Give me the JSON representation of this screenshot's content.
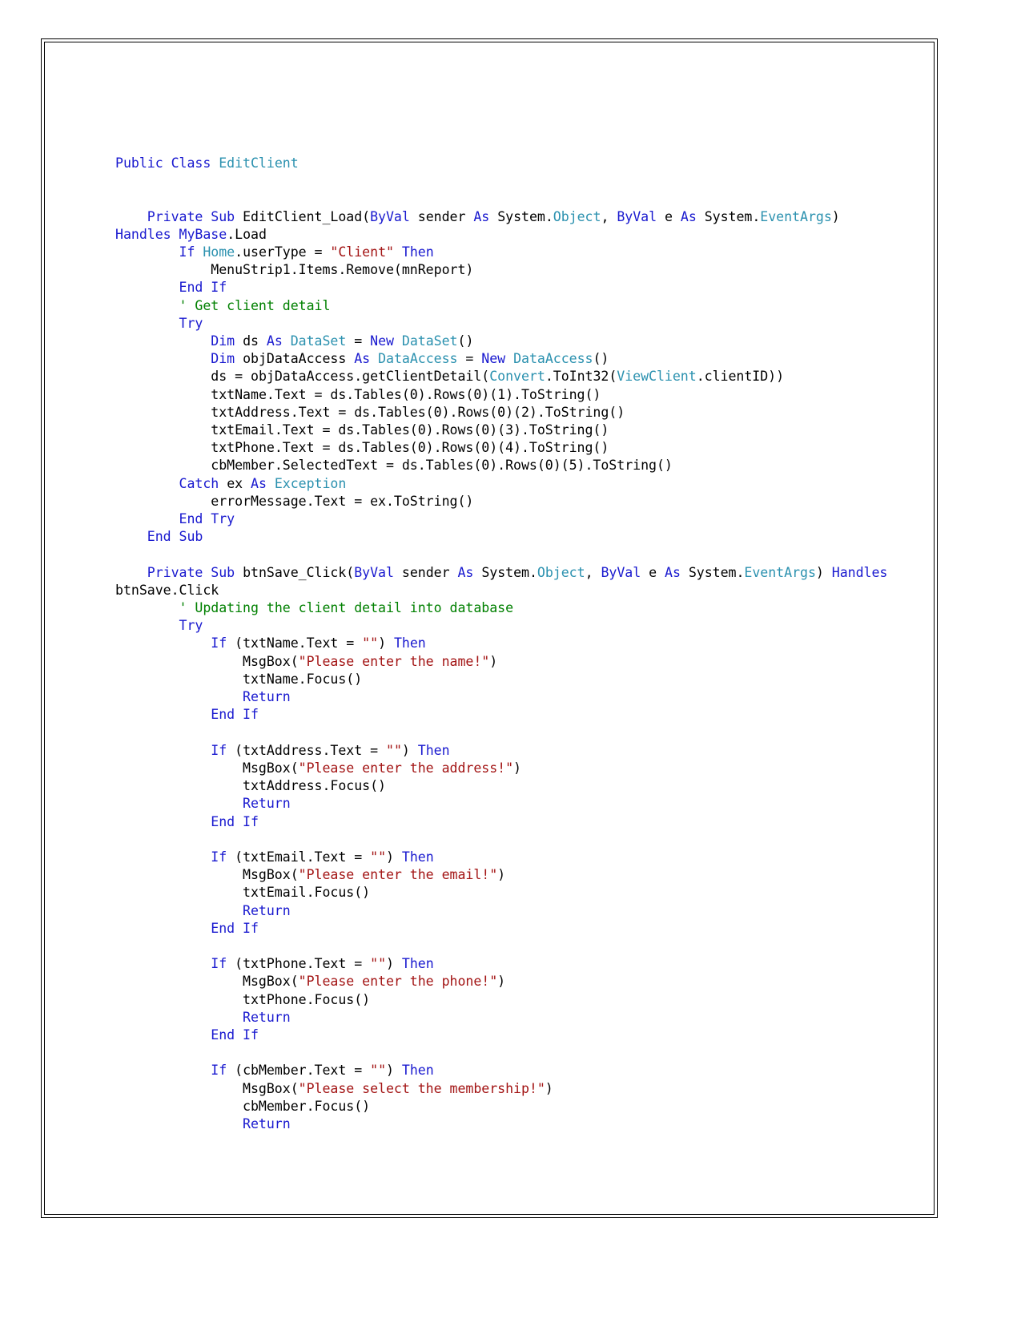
{
  "document": {
    "kind": "source-code-listing",
    "language": "VB.NET",
    "class_name": "EditClient",
    "colors": {
      "keyword": "#1919cf",
      "type": "#2b91af",
      "string": "#a31515",
      "comment": "#008000",
      "plain": "#000000",
      "page_border": "#000000",
      "background": "#ffffff"
    }
  },
  "code": {
    "lines": [
      [
        {
          "t": "kw",
          "v": "Public Class "
        },
        {
          "t": "typ",
          "v": "EditClient"
        }
      ],
      [],
      [],
      [
        {
          "t": "pln",
          "v": "    "
        },
        {
          "t": "kw",
          "v": "Private Sub "
        },
        {
          "t": "pln",
          "v": "EditClient_Load("
        },
        {
          "t": "kw",
          "v": "ByVal "
        },
        {
          "t": "pln",
          "v": "sender "
        },
        {
          "t": "kw",
          "v": "As "
        },
        {
          "t": "pln",
          "v": "System."
        },
        {
          "t": "typ",
          "v": "Object"
        },
        {
          "t": "pln",
          "v": ", "
        },
        {
          "t": "kw",
          "v": "ByVal "
        },
        {
          "t": "pln",
          "v": "e "
        },
        {
          "t": "kw",
          "v": "As "
        },
        {
          "t": "pln",
          "v": "System."
        },
        {
          "t": "typ",
          "v": "EventArgs"
        },
        {
          "t": "pln",
          "v": ") "
        },
        {
          "t": "kw",
          "v": "Handles "
        },
        {
          "t": "kw",
          "v": "MyBase"
        },
        {
          "t": "pln",
          "v": ".Load"
        }
      ],
      [
        {
          "t": "pln",
          "v": "        "
        },
        {
          "t": "kw",
          "v": "If "
        },
        {
          "t": "typ",
          "v": "Home"
        },
        {
          "t": "pln",
          "v": ".userType = "
        },
        {
          "t": "str",
          "v": "\"Client\""
        },
        {
          "t": "pln",
          "v": " "
        },
        {
          "t": "kw",
          "v": "Then"
        }
      ],
      [
        {
          "t": "pln",
          "v": "            MenuStrip1.Items.Remove(mnReport)"
        }
      ],
      [
        {
          "t": "pln",
          "v": "        "
        },
        {
          "t": "kw",
          "v": "End If"
        }
      ],
      [
        {
          "t": "pln",
          "v": "        "
        },
        {
          "t": "cmt",
          "v": "' Get client detail"
        }
      ],
      [
        {
          "t": "pln",
          "v": "        "
        },
        {
          "t": "kw",
          "v": "Try"
        }
      ],
      [
        {
          "t": "pln",
          "v": "            "
        },
        {
          "t": "kw",
          "v": "Dim "
        },
        {
          "t": "pln",
          "v": "ds "
        },
        {
          "t": "kw",
          "v": "As "
        },
        {
          "t": "typ",
          "v": "DataSet"
        },
        {
          "t": "pln",
          "v": " = "
        },
        {
          "t": "kw",
          "v": "New "
        },
        {
          "t": "typ",
          "v": "DataSet"
        },
        {
          "t": "pln",
          "v": "()"
        }
      ],
      [
        {
          "t": "pln",
          "v": "            "
        },
        {
          "t": "kw",
          "v": "Dim "
        },
        {
          "t": "pln",
          "v": "objDataAccess "
        },
        {
          "t": "kw",
          "v": "As "
        },
        {
          "t": "typ",
          "v": "DataAccess"
        },
        {
          "t": "pln",
          "v": " = "
        },
        {
          "t": "kw",
          "v": "New "
        },
        {
          "t": "typ",
          "v": "DataAccess"
        },
        {
          "t": "pln",
          "v": "()"
        }
      ],
      [
        {
          "t": "pln",
          "v": "            ds = objDataAccess.getClientDetail("
        },
        {
          "t": "typ",
          "v": "Convert"
        },
        {
          "t": "pln",
          "v": ".ToInt32("
        },
        {
          "t": "typ",
          "v": "ViewClient"
        },
        {
          "t": "pln",
          "v": ".clientID))"
        }
      ],
      [
        {
          "t": "pln",
          "v": "            txtName.Text = ds.Tables(0).Rows(0)(1).ToString()"
        }
      ],
      [
        {
          "t": "pln",
          "v": "            txtAddress.Text = ds.Tables(0).Rows(0)(2).ToString()"
        }
      ],
      [
        {
          "t": "pln",
          "v": "            txtEmail.Text = ds.Tables(0).Rows(0)(3).ToString()"
        }
      ],
      [
        {
          "t": "pln",
          "v": "            txtPhone.Text = ds.Tables(0).Rows(0)(4).ToString()"
        }
      ],
      [
        {
          "t": "pln",
          "v": "            cbMember.SelectedText = ds.Tables(0).Rows(0)(5).ToString()"
        }
      ],
      [
        {
          "t": "pln",
          "v": "        "
        },
        {
          "t": "kw",
          "v": "Catch "
        },
        {
          "t": "pln",
          "v": "ex "
        },
        {
          "t": "kw",
          "v": "As "
        },
        {
          "t": "typ",
          "v": "Exception"
        }
      ],
      [
        {
          "t": "pln",
          "v": "            errorMessage.Text = ex.ToString()"
        }
      ],
      [
        {
          "t": "pln",
          "v": "        "
        },
        {
          "t": "kw",
          "v": "End Try"
        }
      ],
      [
        {
          "t": "pln",
          "v": "    "
        },
        {
          "t": "kw",
          "v": "End Sub"
        }
      ],
      [],
      [
        {
          "t": "pln",
          "v": "    "
        },
        {
          "t": "kw",
          "v": "Private Sub "
        },
        {
          "t": "pln",
          "v": "btnSave_Click("
        },
        {
          "t": "kw",
          "v": "ByVal "
        },
        {
          "t": "pln",
          "v": "sender "
        },
        {
          "t": "kw",
          "v": "As "
        },
        {
          "t": "pln",
          "v": "System."
        },
        {
          "t": "typ",
          "v": "Object"
        },
        {
          "t": "pln",
          "v": ", "
        },
        {
          "t": "kw",
          "v": "ByVal "
        },
        {
          "t": "pln",
          "v": "e "
        },
        {
          "t": "kw",
          "v": "As "
        },
        {
          "t": "pln",
          "v": "System."
        },
        {
          "t": "typ",
          "v": "EventArgs"
        },
        {
          "t": "pln",
          "v": ") "
        },
        {
          "t": "kw",
          "v": "Handles "
        },
        {
          "t": "pln",
          "v": "btnSave.Click"
        }
      ],
      [
        {
          "t": "pln",
          "v": "        "
        },
        {
          "t": "cmt",
          "v": "' Updating the client detail into database"
        }
      ],
      [
        {
          "t": "pln",
          "v": "        "
        },
        {
          "t": "kw",
          "v": "Try"
        }
      ],
      [
        {
          "t": "pln",
          "v": "            "
        },
        {
          "t": "kw",
          "v": "If "
        },
        {
          "t": "pln",
          "v": "(txtName.Text = "
        },
        {
          "t": "str",
          "v": "\"\""
        },
        {
          "t": "pln",
          "v": ") "
        },
        {
          "t": "kw",
          "v": "Then"
        }
      ],
      [
        {
          "t": "pln",
          "v": "                MsgBox("
        },
        {
          "t": "str",
          "v": "\"Please enter the name!\""
        },
        {
          "t": "pln",
          "v": ")"
        }
      ],
      [
        {
          "t": "pln",
          "v": "                txtName.Focus()"
        }
      ],
      [
        {
          "t": "pln",
          "v": "                "
        },
        {
          "t": "kw",
          "v": "Return"
        }
      ],
      [
        {
          "t": "pln",
          "v": "            "
        },
        {
          "t": "kw",
          "v": "End If"
        }
      ],
      [],
      [
        {
          "t": "pln",
          "v": "            "
        },
        {
          "t": "kw",
          "v": "If "
        },
        {
          "t": "pln",
          "v": "(txtAddress.Text = "
        },
        {
          "t": "str",
          "v": "\"\""
        },
        {
          "t": "pln",
          "v": ") "
        },
        {
          "t": "kw",
          "v": "Then"
        }
      ],
      [
        {
          "t": "pln",
          "v": "                MsgBox("
        },
        {
          "t": "str",
          "v": "\"Please enter the address!\""
        },
        {
          "t": "pln",
          "v": ")"
        }
      ],
      [
        {
          "t": "pln",
          "v": "                txtAddress.Focus()"
        }
      ],
      [
        {
          "t": "pln",
          "v": "                "
        },
        {
          "t": "kw",
          "v": "Return"
        }
      ],
      [
        {
          "t": "pln",
          "v": "            "
        },
        {
          "t": "kw",
          "v": "End If"
        }
      ],
      [],
      [
        {
          "t": "pln",
          "v": "            "
        },
        {
          "t": "kw",
          "v": "If "
        },
        {
          "t": "pln",
          "v": "(txtEmail.Text = "
        },
        {
          "t": "str",
          "v": "\"\""
        },
        {
          "t": "pln",
          "v": ") "
        },
        {
          "t": "kw",
          "v": "Then"
        }
      ],
      [
        {
          "t": "pln",
          "v": "                MsgBox("
        },
        {
          "t": "str",
          "v": "\"Please enter the email!\""
        },
        {
          "t": "pln",
          "v": ")"
        }
      ],
      [
        {
          "t": "pln",
          "v": "                txtEmail.Focus()"
        }
      ],
      [
        {
          "t": "pln",
          "v": "                "
        },
        {
          "t": "kw",
          "v": "Return"
        }
      ],
      [
        {
          "t": "pln",
          "v": "            "
        },
        {
          "t": "kw",
          "v": "End If"
        }
      ],
      [],
      [
        {
          "t": "pln",
          "v": "            "
        },
        {
          "t": "kw",
          "v": "If "
        },
        {
          "t": "pln",
          "v": "(txtPhone.Text = "
        },
        {
          "t": "str",
          "v": "\"\""
        },
        {
          "t": "pln",
          "v": ") "
        },
        {
          "t": "kw",
          "v": "Then"
        }
      ],
      [
        {
          "t": "pln",
          "v": "                MsgBox("
        },
        {
          "t": "str",
          "v": "\"Please enter the phone!\""
        },
        {
          "t": "pln",
          "v": ")"
        }
      ],
      [
        {
          "t": "pln",
          "v": "                txtPhone.Focus()"
        }
      ],
      [
        {
          "t": "pln",
          "v": "                "
        },
        {
          "t": "kw",
          "v": "Return"
        }
      ],
      [
        {
          "t": "pln",
          "v": "            "
        },
        {
          "t": "kw",
          "v": "End If"
        }
      ],
      [],
      [
        {
          "t": "pln",
          "v": "            "
        },
        {
          "t": "kw",
          "v": "If "
        },
        {
          "t": "pln",
          "v": "(cbMember.Text = "
        },
        {
          "t": "str",
          "v": "\"\""
        },
        {
          "t": "pln",
          "v": ") "
        },
        {
          "t": "kw",
          "v": "Then"
        }
      ],
      [
        {
          "t": "pln",
          "v": "                MsgBox("
        },
        {
          "t": "str",
          "v": "\"Please select the membership!\""
        },
        {
          "t": "pln",
          "v": ")"
        }
      ],
      [
        {
          "t": "pln",
          "v": "                cbMember.Focus()"
        }
      ],
      [
        {
          "t": "pln",
          "v": "                "
        },
        {
          "t": "kw",
          "v": "Return"
        }
      ]
    ]
  }
}
